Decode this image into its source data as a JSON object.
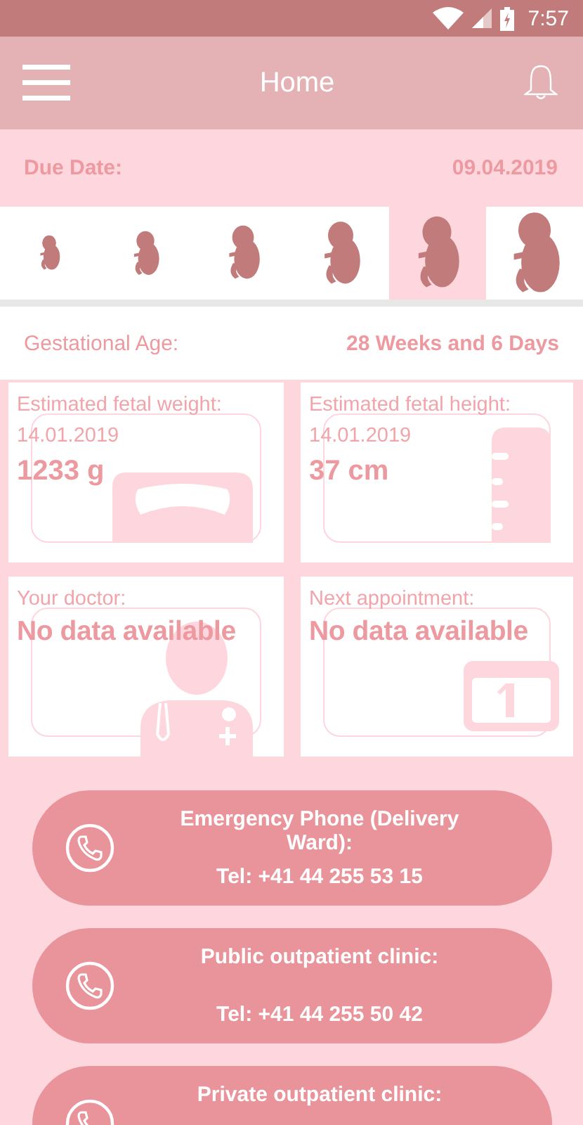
{
  "status_bar": {
    "time": "7:57"
  },
  "app_bar": {
    "title": "Home"
  },
  "due_date": {
    "label": "Due Date:",
    "value": "09.04.2019"
  },
  "stages": [
    {
      "selected": false
    },
    {
      "selected": false
    },
    {
      "selected": false
    },
    {
      "selected": false
    },
    {
      "selected": true
    },
    {
      "selected": false
    }
  ],
  "gestational_age": {
    "label": "Gestational Age:",
    "value": "28 Weeks and 6 Days"
  },
  "cards": [
    {
      "kind": "weight",
      "label": "Estimated fetal weight:",
      "date": "14.01.2019",
      "value": "1233 g"
    },
    {
      "kind": "height",
      "label": "Estimated fetal height:",
      "date": "14.01.2019",
      "value": "37 cm"
    },
    {
      "kind": "doctor",
      "label": "Your doctor:",
      "value": "No data available"
    },
    {
      "kind": "appointment",
      "label": "Next appointment:",
      "value": "No data available"
    }
  ],
  "contacts": [
    {
      "title": "Emergency Phone (Delivery Ward):",
      "phone": "Tel: +41 44 255 53 15"
    },
    {
      "title": "Public outpatient clinic:",
      "phone": "Tel: +41 44 255 50 42"
    },
    {
      "title": "Private outpatient clinic:"
    }
  ]
}
